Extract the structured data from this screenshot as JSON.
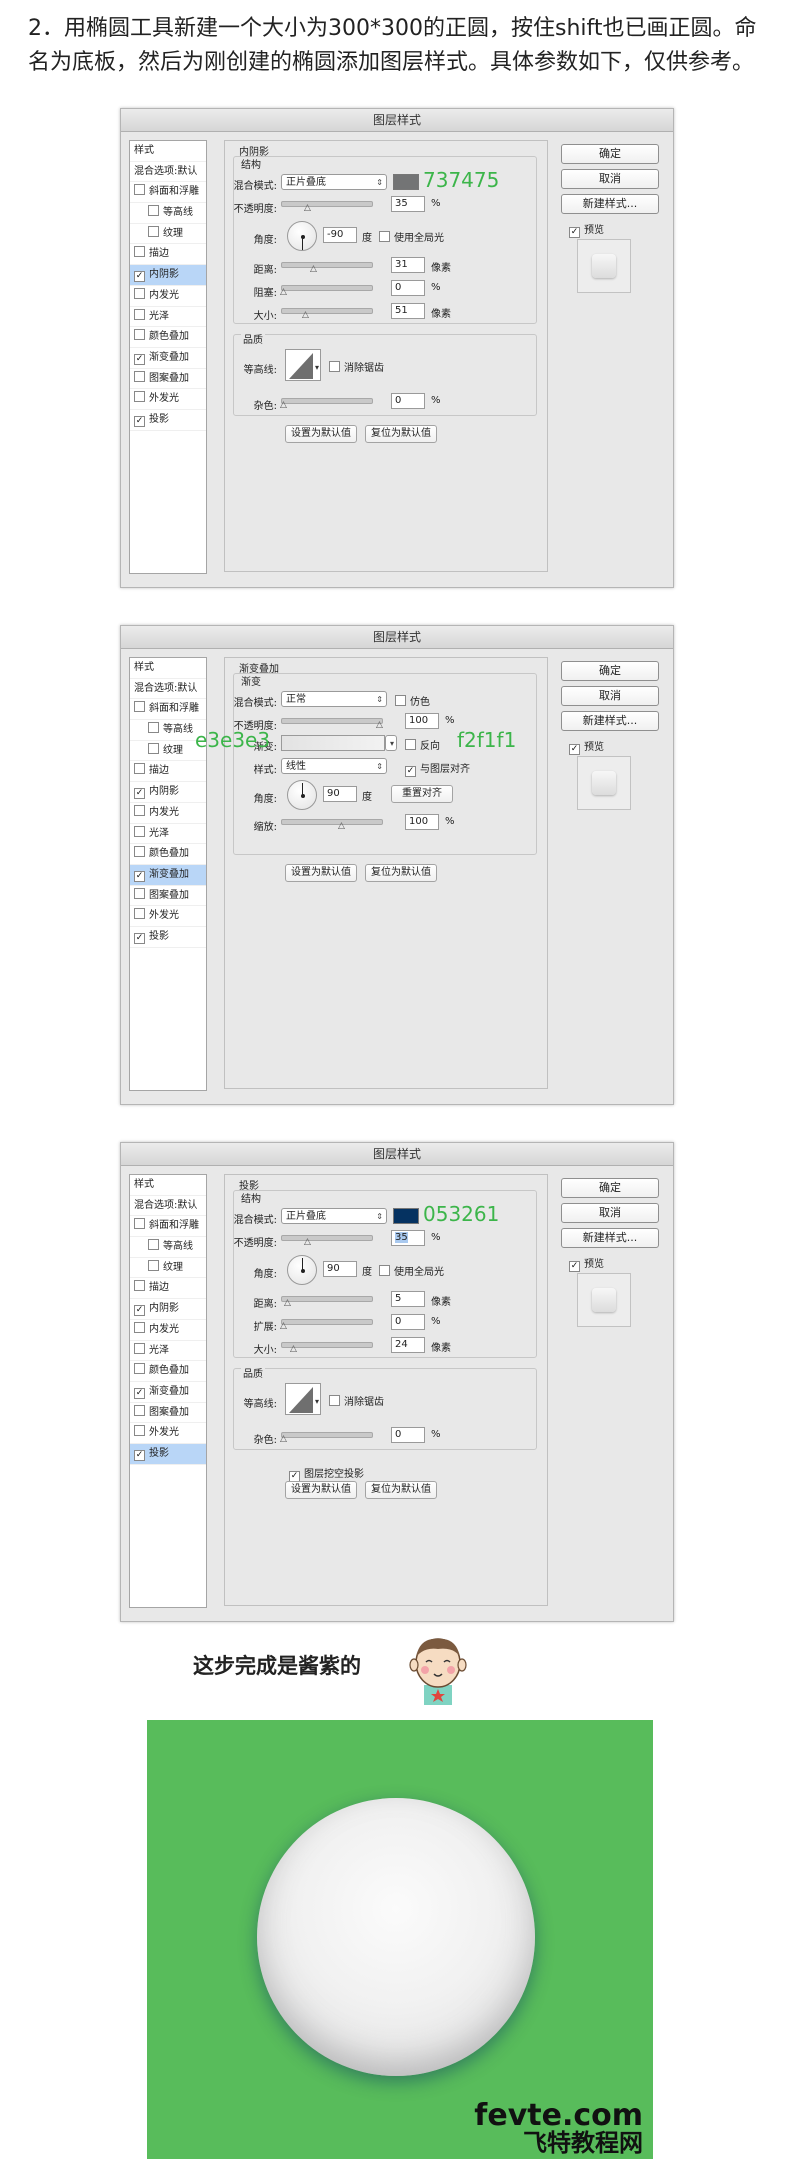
{
  "intro": "2．用椭圆工具新建一个大小为300*300的正圆，按住shift也已画正圆。命名为底板，然后为刚创建的椭圆添加图层样式。具体参数如下，仅供参考。",
  "dialog_title": "图层样式",
  "buttons": {
    "ok": "确定",
    "cancel": "取消",
    "new_style": "新建样式...",
    "preview": "预览",
    "set_default": "设置为默认值",
    "reset_default": "复位为默认值"
  },
  "sidebar": {
    "header": "样式",
    "blend_default": "混合选项:默认",
    "items": [
      {
        "label": "斜面和浮雕",
        "checked": false,
        "level": 1
      },
      {
        "label": "等高线",
        "checked": false,
        "level": 2
      },
      {
        "label": "纹理",
        "checked": false,
        "level": 2
      },
      {
        "label": "描边",
        "checked": false,
        "level": 1
      },
      {
        "label": "内阴影",
        "checked": true,
        "level": 1
      },
      {
        "label": "内发光",
        "checked": false,
        "level": 1
      },
      {
        "label": "光泽",
        "checked": false,
        "level": 1
      },
      {
        "label": "颜色叠加",
        "checked": false,
        "level": 1
      },
      {
        "label": "渐变叠加",
        "checked": true,
        "level": 1
      },
      {
        "label": "图案叠加",
        "checked": false,
        "level": 1
      },
      {
        "label": "外发光",
        "checked": false,
        "level": 1
      },
      {
        "label": "投影",
        "checked": true,
        "level": 1
      }
    ]
  },
  "inner_shadow": {
    "title": "内阴影",
    "structure": "结构",
    "blend_mode_label": "混合模式:",
    "blend_mode": "正片叠底",
    "color_note": "737475",
    "color": "#737475",
    "opacity_label": "不透明度:",
    "opacity": "35",
    "angle_label": "角度:",
    "angle": "-90",
    "deg": "度",
    "global_light": "使用全局光",
    "distance_label": "距离:",
    "distance": "31",
    "choke_label": "阻塞:",
    "choke": "0",
    "size_label": "大小:",
    "size": "51",
    "px": "像素",
    "pct": "%",
    "quality": "品质",
    "contour_label": "等高线:",
    "anti_alias": "消除锯齿",
    "noise_label": "杂色:",
    "noise": "0"
  },
  "gradient_overlay": {
    "title": "渐变叠加",
    "sub": "渐变",
    "blend_mode_label": "混合模式:",
    "blend_mode": "正常",
    "dither": "仿色",
    "opacity_label": "不透明度:",
    "opacity": "100",
    "gradient_label": "渐变:",
    "reverse": "反向",
    "color_left_note": "e3e3e3",
    "color_right_note": "f2f1f1",
    "style_label": "样式:",
    "style": "线性",
    "align_layer": "与图层对齐",
    "angle_label": "角度:",
    "angle": "90",
    "deg": "度",
    "reset_align": "重置对齐",
    "scale_label": "缩放:",
    "scale": "100",
    "pct": "%"
  },
  "drop_shadow": {
    "title": "投影",
    "structure": "结构",
    "blend_mode_label": "混合模式:",
    "blend_mode": "正片叠底",
    "color_note": "053261",
    "color": "#053261",
    "opacity_label": "不透明度:",
    "opacity": "35",
    "angle_label": "角度:",
    "angle": "90",
    "deg": "度",
    "global_light": "使用全局光",
    "distance_label": "距离:",
    "distance": "5",
    "spread_label": "扩展:",
    "spread": "0",
    "size_label": "大小:",
    "size": "24",
    "px": "像素",
    "pct": "%",
    "quality": "品质",
    "contour_label": "等高线:",
    "anti_alias": "消除锯齿",
    "noise_label": "杂色:",
    "noise": "0",
    "knockout": "图层挖空投影"
  },
  "done_text": "这步完成是酱紫的",
  "watermark": {
    "en": "fevte.com",
    "cn": "飞特教程网"
  },
  "colors": {
    "green_bg": "#58bc5b",
    "note_green": "#3cb54a",
    "selection": "#b9d6f7"
  }
}
